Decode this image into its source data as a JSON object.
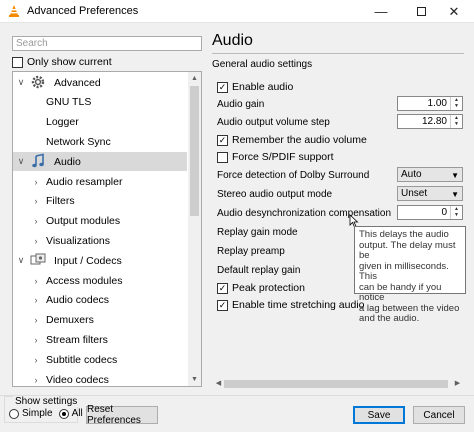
{
  "window": {
    "title": "Advanced Preferences",
    "minimize_glyph": "—",
    "close_glyph": "✕"
  },
  "sidebar": {
    "search_placeholder": "Search",
    "only_show_current_label": "Only show current",
    "only_show_current_checked": false,
    "tree": [
      {
        "label": "Advanced",
        "expander": "∨",
        "icon": "gear-icon",
        "selected": false
      },
      {
        "label": "GNU TLS",
        "expander": "",
        "icon": "",
        "selected": false
      },
      {
        "label": "Logger",
        "expander": "",
        "icon": "",
        "selected": false
      },
      {
        "label": "Network Sync",
        "expander": "",
        "icon": "",
        "selected": false
      },
      {
        "label": "Audio",
        "expander": "∨",
        "icon": "music-note-icon",
        "selected": true
      },
      {
        "label": "Audio resampler",
        "expander": "›",
        "icon": "",
        "selected": false
      },
      {
        "label": "Filters",
        "expander": "›",
        "icon": "",
        "selected": false
      },
      {
        "label": "Output modules",
        "expander": "›",
        "icon": "",
        "selected": false
      },
      {
        "label": "Visualizations",
        "expander": "›",
        "icon": "",
        "selected": false
      },
      {
        "label": "Input / Codecs",
        "expander": "∨",
        "icon": "input-codecs-icon",
        "selected": false
      },
      {
        "label": "Access modules",
        "expander": "›",
        "icon": "",
        "selected": false
      },
      {
        "label": "Audio codecs",
        "expander": "›",
        "icon": "",
        "selected": false
      },
      {
        "label": "Demuxers",
        "expander": "›",
        "icon": "",
        "selected": false
      },
      {
        "label": "Stream filters",
        "expander": "›",
        "icon": "",
        "selected": false
      },
      {
        "label": "Subtitle codecs",
        "expander": "›",
        "icon": "",
        "selected": false
      },
      {
        "label": "Video codecs",
        "expander": "›",
        "icon": "",
        "selected": false
      }
    ]
  },
  "main": {
    "section_title": "Audio",
    "group_title": "General audio settings",
    "enable_audio": {
      "label": "Enable audio",
      "checked": true
    },
    "audio_gain": {
      "label": "Audio gain",
      "value": "1.00"
    },
    "volume_step": {
      "label": "Audio output volume step",
      "value": "12.80"
    },
    "remember_volume": {
      "label": "Remember the audio volume",
      "checked": true
    },
    "force_spdif": {
      "label": "Force S/PDIF support",
      "checked": false
    },
    "dolby": {
      "label": "Force detection of Dolby Surround",
      "value": "Auto"
    },
    "stereo_mode": {
      "label": "Stereo audio output mode",
      "value": "Unset"
    },
    "desync": {
      "label": "Audio desynchronization compensation",
      "value": "0"
    },
    "replay_gain_mode": {
      "label": "Replay gain mode"
    },
    "replay_preamp": {
      "label": "Replay preamp"
    },
    "default_replay_gain": {
      "label": "Default replay gain"
    },
    "peak_protection": {
      "label": "Peak protection",
      "checked": true
    },
    "time_stretching": {
      "label": "Enable time stretching audio",
      "checked": true
    }
  },
  "tooltip": {
    "lines": [
      "This delays the audio",
      "output. The delay must be",
      "given in milliseconds. This",
      "can be handy if you notice",
      "a lag between the video",
      "and the audio."
    ]
  },
  "footer": {
    "show_settings_label": "Show settings",
    "simple_label": "Simple",
    "all_label": "All",
    "selected_mode": "All",
    "reset_label": "Reset Preferences",
    "save_label": "Save",
    "cancel_label": "Cancel"
  },
  "colors": {
    "selection": "#d9d9d9",
    "default_button_border": "#0078d7",
    "vlc_orange": "#f48b00"
  }
}
